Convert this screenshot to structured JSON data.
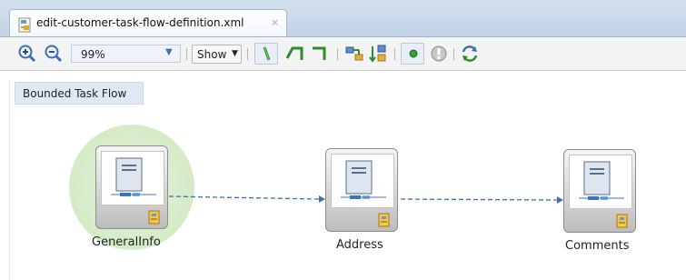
{
  "editor_tab": {
    "title": "edit-customer-task-flow-definition.xml",
    "close_glyph": "×",
    "icon": "xml-file-icon"
  },
  "toolbar": {
    "zoom_in_icon": "zoom-in-icon",
    "zoom_out_icon": "zoom-out-icon",
    "zoom_value": "99%",
    "show_label": "Show",
    "tools": [
      {
        "icon": "select-tool-icon",
        "selected": true
      },
      {
        "icon": "orthogonal-connector-left-icon",
        "selected": false
      },
      {
        "icon": "orthogonal-connector-right-icon",
        "selected": false
      },
      {
        "icon": "horizontal-layout-icon",
        "selected": false
      },
      {
        "icon": "vertical-layout-icon",
        "selected": false
      },
      {
        "icon": "show-default-activity-icon",
        "selected": true
      },
      {
        "icon": "show-exceptions-icon",
        "selected": false
      },
      {
        "icon": "refresh-icon",
        "selected": false
      }
    ]
  },
  "diagram": {
    "header_label": "Bounded Task Flow",
    "activities": [
      {
        "name": "GeneralInfo",
        "default_activity": true,
        "icon": "view-activity-icon"
      },
      {
        "name": "Address",
        "default_activity": false,
        "icon": "view-activity-icon"
      },
      {
        "name": "Comments",
        "default_activity": false,
        "icon": "view-activity-icon"
      }
    ],
    "transitions": [
      {
        "from": "GeneralInfo",
        "to": "Address"
      },
      {
        "from": "Address",
        "to": "Comments"
      }
    ],
    "colors": {
      "connector": "#3f6fb5",
      "default_highlight": "#d4ebc6",
      "selection": "#e7eef7"
    }
  }
}
